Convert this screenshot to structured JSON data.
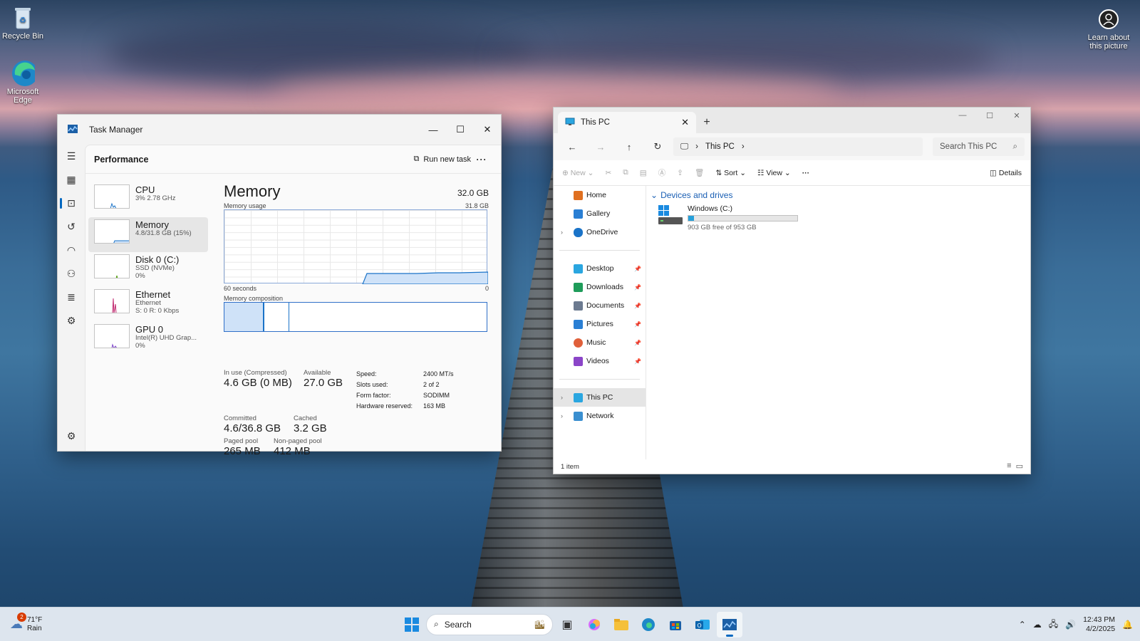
{
  "desktop": {
    "recycle_bin": "Recycle Bin",
    "edge": "Microsoft Edge",
    "learn": "Learn about this picture"
  },
  "task_manager": {
    "title": "Task Manager",
    "page": "Performance",
    "run_new_task": "Run new task",
    "items": [
      {
        "name": "CPU",
        "sub1": "3% 2.78 GHz",
        "sub2": ""
      },
      {
        "name": "Memory",
        "sub1": "4.8/31.8 GB (15%)",
        "sub2": ""
      },
      {
        "name": "Disk 0 (C:)",
        "sub1": "SSD (NVMe)",
        "sub2": "0%"
      },
      {
        "name": "Ethernet",
        "sub1": "Ethernet",
        "sub2": "S: 0 R: 0 Kbps"
      },
      {
        "name": "GPU 0",
        "sub1": "Intel(R) UHD Grap...",
        "sub2": "0%"
      }
    ],
    "detail": {
      "title": "Memory",
      "total": "32.0 GB",
      "usage_label": "Memory usage",
      "usage_max": "31.8 GB",
      "time_label": "60 seconds",
      "time_zero": "0",
      "composition_label": "Memory composition",
      "in_use_label": "In use (Compressed)",
      "in_use": "4.6 GB (0 MB)",
      "available_label": "Available",
      "available": "27.0 GB",
      "committed_label": "Committed",
      "committed": "4.6/36.8 GB",
      "cached_label": "Cached",
      "cached": "3.2 GB",
      "paged_label": "Paged pool",
      "paged": "265 MB",
      "nonpaged_label": "Non-paged pool",
      "nonpaged": "412 MB",
      "speed_label": "Speed:",
      "speed": "2400 MT/s",
      "slots_label": "Slots used:",
      "slots": "2 of 2",
      "form_label": "Form factor:",
      "form": "SODIMM",
      "hw_label": "Hardware reserved:",
      "hw": "163 MB"
    }
  },
  "explorer": {
    "tab": "This PC",
    "breadcrumb": "This PC",
    "search_placeholder": "Search This PC",
    "cmd": {
      "new": "New",
      "sort": "Sort",
      "view": "View",
      "details": "Details"
    },
    "nav": [
      {
        "label": "Home",
        "color": "#e07020"
      },
      {
        "label": "Gallery",
        "color": "#2a7fd4"
      },
      {
        "label": "OneDrive",
        "color": "#1a73c8"
      }
    ],
    "quick": [
      {
        "label": "Desktop",
        "color": "#2aa6e0"
      },
      {
        "label": "Downloads",
        "color": "#1f9c5a"
      },
      {
        "label": "Documents",
        "color": "#6c7a90"
      },
      {
        "label": "Pictures",
        "color": "#2a7fd4"
      },
      {
        "label": "Music",
        "color": "#e0603a"
      },
      {
        "label": "Videos",
        "color": "#8b45c8"
      }
    ],
    "bottom": [
      {
        "label": "This PC"
      },
      {
        "label": "Network"
      }
    ],
    "group": "Devices and drives",
    "drive": {
      "name": "Windows (C:)",
      "free": "903 GB free of 953 GB",
      "used_fraction": 0.052
    },
    "status": "1 item"
  },
  "taskbar": {
    "weather_temp": "71°F",
    "weather_cond": "Rain",
    "weather_badge": "2",
    "search": "Search",
    "time": "12:43 PM",
    "date": "4/2/2025"
  }
}
